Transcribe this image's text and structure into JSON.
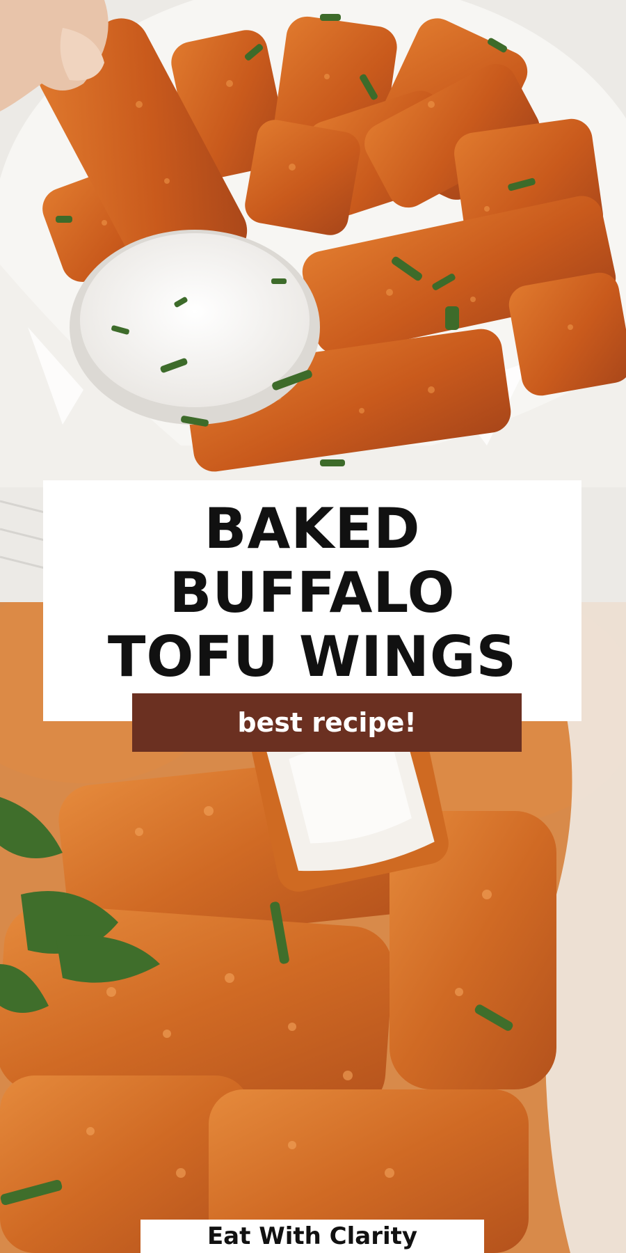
{
  "title": {
    "lines": [
      "BAKED",
      "BUFFALO",
      "TOFU WINGS"
    ]
  },
  "tagline": "best recipe!",
  "brand": "Eat With Clarity",
  "colors": {
    "banner": "#6b3021",
    "title_text": "#111111",
    "card": "#ffffff",
    "sauce": "#c9591c"
  },
  "images": {
    "top": "buffalo-tofu-wings-basket-photo",
    "bottom": "buffalo-tofu-wing-closeup-photo"
  }
}
